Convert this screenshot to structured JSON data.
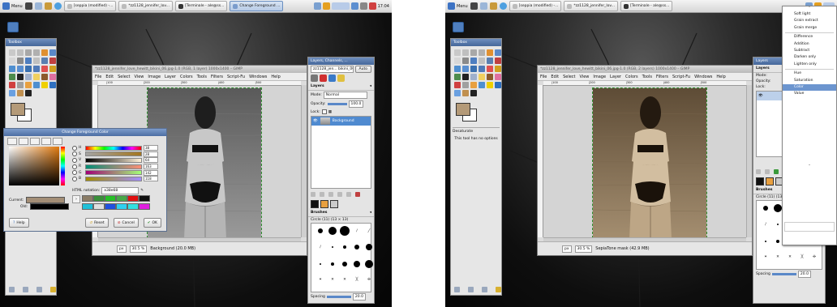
{
  "shots": [
    {
      "taskbar": {
        "menu_label": "Menu",
        "tasks": [
          "[seppia (modified) -...",
          "*zz1128_jennifer_lov...",
          "[Terminale - ale@ss...",
          "Change Foreground ..."
        ],
        "active_task_index": 3,
        "clock": "17:04"
      },
      "toolbox": {
        "title": "Toolbox",
        "fg_color": "#b49a78"
      },
      "image_window": {
        "title": "*zz1128_jennifer_love_hewitt_bikini_06.jpg-1.0 (RGB, 1 layer) 1000x1400 – GIMP",
        "menu": [
          "File",
          "Edit",
          "Select",
          "View",
          "Image",
          "Layer",
          "Colors",
          "Tools",
          "Filters",
          "Script-Fu",
          "Windows",
          "Help"
        ],
        "ruler_ticks": [
          "|100",
          "|200",
          "|300",
          "|400",
          "|500"
        ],
        "unit": "px",
        "zoom": "30.5 %",
        "status": "Background (20.0 MB)",
        "tone": "grayscale"
      },
      "layers_dock": {
        "title": "Layers, Channels, ...",
        "image_combo": "zz1128_jen... bikini_06.jpg-1",
        "auto_label": "Auto",
        "section": "Layers",
        "mode_label": "Mode:",
        "mode_value": "Normal",
        "opacity_label": "Opacity:",
        "opacity_value": "100.0",
        "lock_label": "Lock:",
        "layer_name": "Background",
        "brushes_title": "Brushes",
        "brush_name": "Circle (11) (13 × 13)",
        "spacing_label": "Spacing",
        "spacing_value": "20.0"
      },
      "color_dialog": {
        "title": "Change Foreground Color",
        "channels": [
          {
            "label": "H",
            "value": "38"
          },
          {
            "label": "S",
            "value": "28"
          },
          {
            "label": "V",
            "value": "64"
          },
          {
            "label": "R",
            "value": "163"
          },
          {
            "label": "G",
            "value": "142"
          },
          {
            "label": "B",
            "value": "118"
          }
        ],
        "hex_label": "HTML notation:",
        "hex_value": "a38e68",
        "current_label": "Current:",
        "old_label": "Old:",
        "current_color": "#a38e76",
        "old_color": "#000000",
        "swatches": [
          "#8a7c66",
          "#3a8f3a",
          "#27c027",
          "#48a848",
          "#e01010",
          "#101010",
          "#20c0d8",
          "#e0e0e0",
          "#2050e0",
          "#2fd0f0",
          "#30e0e0",
          "#e020e0"
        ],
        "help_label": "Help",
        "reset_label": "Reset",
        "cancel_label": "Cancel",
        "ok_label": "OK"
      }
    },
    {
      "taskbar": {
        "menu_label": "Menu",
        "tasks": [
          "[seppia (modified) -...",
          "*zz1128_jennifer_lov...",
          "[Terminale - ale@ss..."
        ],
        "active_task_index": -1
      },
      "toolbox": {
        "title": "Toolbox",
        "fg_color": "#b49a78",
        "options_title": "Desaturate",
        "options_text": "This tool has no options"
      },
      "image_window": {
        "title": "*zz1128_jennifer_love_hewitt_bikini_06.jpg-1.0 (RGB, 2 layers) 1000x1400 – GIMP",
        "menu": [
          "File",
          "Edit",
          "Select",
          "View",
          "Image",
          "Layer",
          "Colors",
          "Tools",
          "Filters",
          "Script-Fu",
          "Windows",
          "Help"
        ],
        "ruler_ticks": [
          "|100",
          "|200",
          "|300",
          "|400",
          "|500"
        ],
        "unit": "px",
        "zoom": "30.5 %",
        "status": "SepiaTone mask (42.9 MB)",
        "tone": "sepia"
      },
      "layers_dock": {
        "title": "Layers",
        "section": "Layers",
        "mode_label": "Mode:",
        "opacity_label": "Opacity:",
        "lock_label": "Lock:",
        "brushes_title": "Brushes",
        "brush_name": "Circle (11) (13 × 13)",
        "spacing_label": "Spacing",
        "spacing_value": "20.0"
      },
      "mode_dropdown": {
        "items": [
          "Soft light",
          "Grain extract",
          "Grain merge",
          "-",
          "Difference",
          "Addition",
          "Subtract",
          "Darken only",
          "Lighten only",
          "-",
          "Hue",
          "Saturation",
          "Color",
          "Value"
        ],
        "selected": "Color"
      }
    }
  ]
}
